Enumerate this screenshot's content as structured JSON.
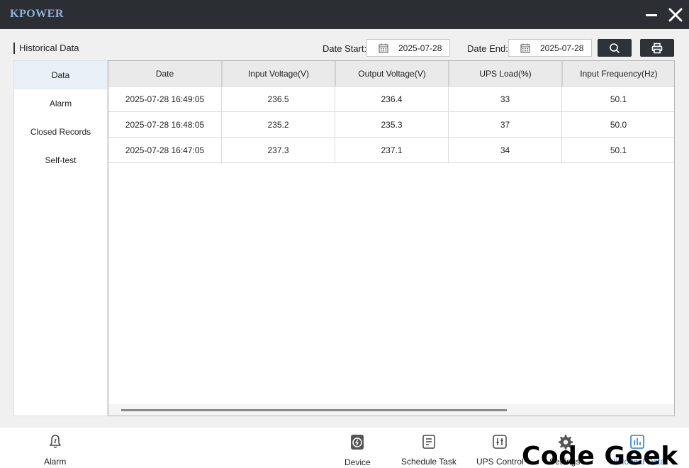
{
  "app": {
    "brand": "KPOWER"
  },
  "header": {
    "section_title": "Historical Data",
    "date_start_label": "Date Start:",
    "date_start_value": "2025-07-28",
    "date_end_label": "Date End:",
    "date_end_value": "2025-07-28"
  },
  "sidebar": {
    "items": [
      {
        "label": "Data",
        "active": true
      },
      {
        "label": "Alarm",
        "active": false
      },
      {
        "label": "Closed Records",
        "active": false
      },
      {
        "label": "Self-test",
        "active": false
      }
    ]
  },
  "table": {
    "columns": [
      "Date",
      "Input Voltage(V)",
      "Output Voltage(V)",
      "UPS Load(%)",
      "Input Frequency(Hz)"
    ],
    "rows": [
      [
        "2025-07-28 16:49:05",
        "236.5",
        "236.4",
        "33",
        "50.1"
      ],
      [
        "2025-07-28 16:48:05",
        "235.2",
        "235.3",
        "37",
        "50.0"
      ],
      [
        "2025-07-28 16:47:05",
        "237.3",
        "237.1",
        "34",
        "50.1"
      ]
    ]
  },
  "bottom_nav": {
    "items": [
      {
        "label": "Alarm",
        "icon": "alarm-bell-icon"
      },
      {
        "label": "Device",
        "icon": "device-power-icon"
      },
      {
        "label": "Schedule Task",
        "icon": "schedule-task-icon"
      },
      {
        "label": "UPS Control",
        "icon": "ups-control-icon"
      },
      {
        "label": "Settings",
        "icon": "gear-icon"
      },
      {
        "label": "Historical Data",
        "icon": "historical-data-icon"
      }
    ]
  },
  "watermark": "Code Geek",
  "colors": {
    "titlebar": "#2b2e33",
    "brand": "#8fb4e0",
    "button_dark": "#2f3338",
    "active_nav": "#2a7fd4"
  }
}
